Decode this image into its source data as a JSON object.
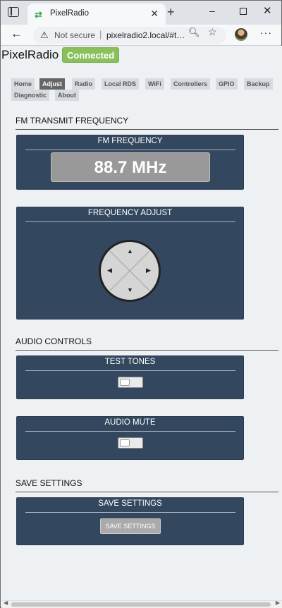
{
  "browser": {
    "tab_title": "PixelRadio",
    "tab_close": "✕",
    "new_tab": "+",
    "not_secure": "Not secure",
    "url": "pixelradio2.local/#t…",
    "more": "···",
    "min": "–",
    "close": "✕"
  },
  "app": {
    "brand": "PixelRadio",
    "status": "Connected"
  },
  "nav": {
    "items": [
      "Home",
      "Adjust",
      "Radio",
      "Local RDS",
      "WiFi",
      "Controllers",
      "GPIO",
      "Backup",
      "Diagnostic",
      "About"
    ],
    "active": "Adjust"
  },
  "sections": {
    "fm_transmit": "FM TRANSMIT FREQUENCY",
    "audio_controls": "AUDIO CONTROLS",
    "save_settings": "SAVE SETTINGS"
  },
  "panels": {
    "fm_frequency": {
      "title": "FM FREQUENCY",
      "value": "88.7 MHz"
    },
    "frequency_adjust": {
      "title": "FREQUENCY ADJUST"
    },
    "test_tones": {
      "title": "TEST TONES",
      "enabled": false
    },
    "audio_mute": {
      "title": "AUDIO MUTE",
      "enabled": false
    },
    "save": {
      "title": "SAVE SETTINGS",
      "button_label": "SAVE SETTINGS"
    }
  },
  "colors": {
    "panel_bg": "#33475e",
    "status_bg": "#8ac05a",
    "active_tab_bg": "#666666"
  }
}
